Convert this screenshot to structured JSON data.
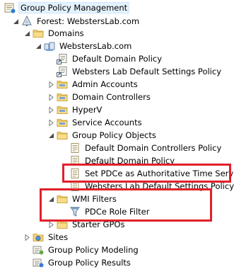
{
  "tree": {
    "root": "Group Policy Management",
    "forest": "Forest: WebstersLab.com",
    "domains": "Domains",
    "domain": "WebstersLab.com",
    "items": {
      "default_domain_policy": "Default Domain Policy",
      "websters_default_settings": "Websters Lab Default Settings Policy",
      "admin_accounts": "Admin Accounts",
      "domain_controllers": "Domain Controllers",
      "hyperv": "HyperV",
      "service_accounts": "Service Accounts",
      "gpo_folder": "Group Policy Objects",
      "gpo_default_dc": "Default Domain Controllers Policy",
      "gpo_default_domain": "Default Domain Policy",
      "gpo_set_pdce": "Set PDCe as Authoritative Time Server",
      "gpo_websters": "Websters Lab Default Settings Policy",
      "wmi_filters": "WMI Filters",
      "pdce_role_filter": "PDCe Role Filter",
      "starter_gpos": "Starter GPOs",
      "sites": "Sites",
      "modeling": "Group Policy Modeling",
      "results": "Group Policy Results"
    }
  },
  "colors": {
    "highlight": "#e0202a",
    "folder": "#e8c25a",
    "selection_bg": "#e5f3ff"
  },
  "icons": {
    "root": "group-policy-management-icon",
    "forest": "forest-icon",
    "folder": "folder-icon",
    "domain": "domain-icon",
    "gpo_link": "gpo-link-icon",
    "ou": "organizational-unit-icon",
    "gpo": "gpo-scroll-icon",
    "wmi": "wmi-filter-icon",
    "sites": "sites-icon",
    "modeling": "modeling-icon",
    "results": "results-icon"
  }
}
